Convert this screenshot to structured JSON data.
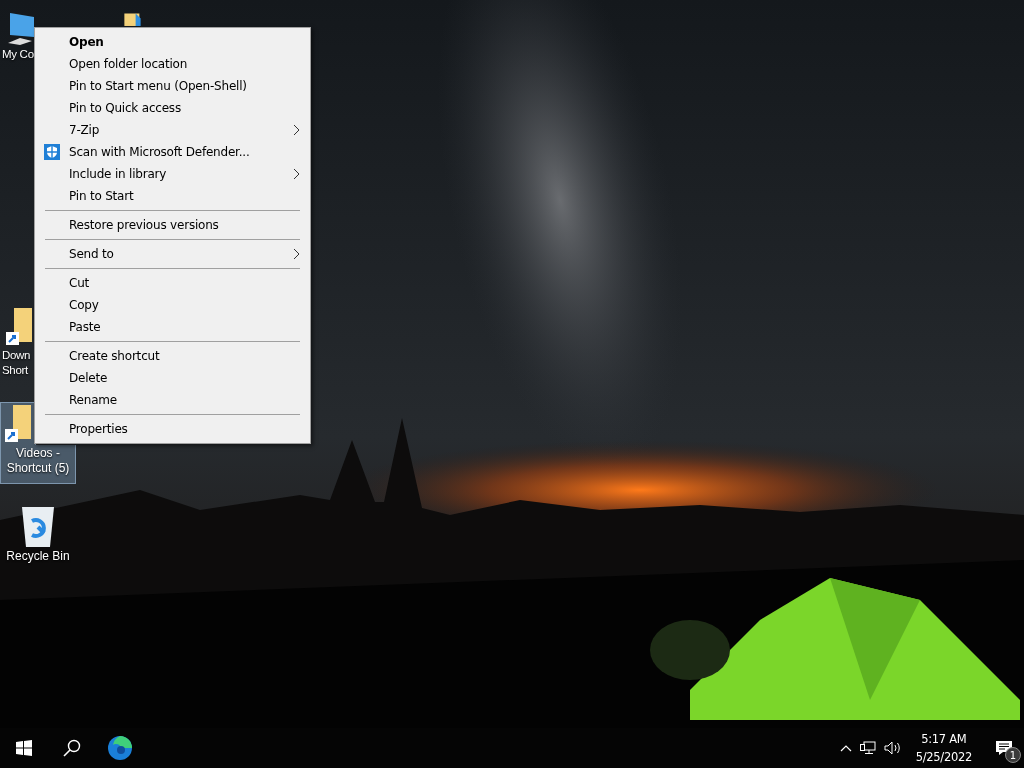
{
  "desktop": {
    "icons": [
      {
        "label": "My Co",
        "kind": "computer",
        "selected": false
      },
      {
        "kind": "folder",
        "selected": false
      },
      {
        "label": "Down\nShort",
        "kind": "shortcut",
        "selected": false
      },
      {
        "label": "Videos -\nShortcut (5)",
        "kind": "shortcut",
        "selected": true
      },
      {
        "label": "Recycle Bin",
        "kind": "recycle",
        "selected": false
      }
    ]
  },
  "context_menu": {
    "items": [
      {
        "kind": "item",
        "label": "Open",
        "default": true,
        "submenu": false
      },
      {
        "kind": "item",
        "label": "Open folder location",
        "default": false,
        "submenu": false
      },
      {
        "kind": "item",
        "label": "Pin to Start menu (Open-Shell)",
        "default": false,
        "submenu": false
      },
      {
        "kind": "item",
        "label": "Pin to Quick access",
        "default": false,
        "submenu": false
      },
      {
        "kind": "item",
        "label": "7-Zip",
        "default": false,
        "submenu": true
      },
      {
        "kind": "shield-item",
        "label": "Scan with Microsoft Defender...",
        "default": false,
        "submenu": false
      },
      {
        "kind": "item",
        "label": "Include in library",
        "default": false,
        "submenu": true
      },
      {
        "kind": "item",
        "label": "Pin to Start",
        "default": false,
        "submenu": false
      },
      {
        "kind": "separator"
      },
      {
        "kind": "item",
        "label": "Restore previous versions",
        "default": false,
        "submenu": false
      },
      {
        "kind": "separator"
      },
      {
        "kind": "item",
        "label": "Send to",
        "default": false,
        "submenu": true
      },
      {
        "kind": "separator"
      },
      {
        "kind": "item",
        "label": "Cut",
        "default": false,
        "submenu": false
      },
      {
        "kind": "item",
        "label": "Copy",
        "default": false,
        "submenu": false
      },
      {
        "kind": "item",
        "label": "Paste",
        "default": false,
        "submenu": false
      },
      {
        "kind": "separator"
      },
      {
        "kind": "item",
        "label": "Create shortcut",
        "default": false,
        "submenu": false
      },
      {
        "kind": "item",
        "label": "Delete",
        "default": false,
        "submenu": false
      },
      {
        "kind": "item",
        "label": "Rename",
        "default": false,
        "submenu": false
      },
      {
        "kind": "separator"
      },
      {
        "kind": "item",
        "label": "Properties",
        "default": false,
        "submenu": false
      }
    ]
  },
  "taskbar": {
    "clock": {
      "time": "5:17 AM",
      "date": "5/25/2022"
    },
    "notifications": {
      "badge": "1"
    }
  }
}
